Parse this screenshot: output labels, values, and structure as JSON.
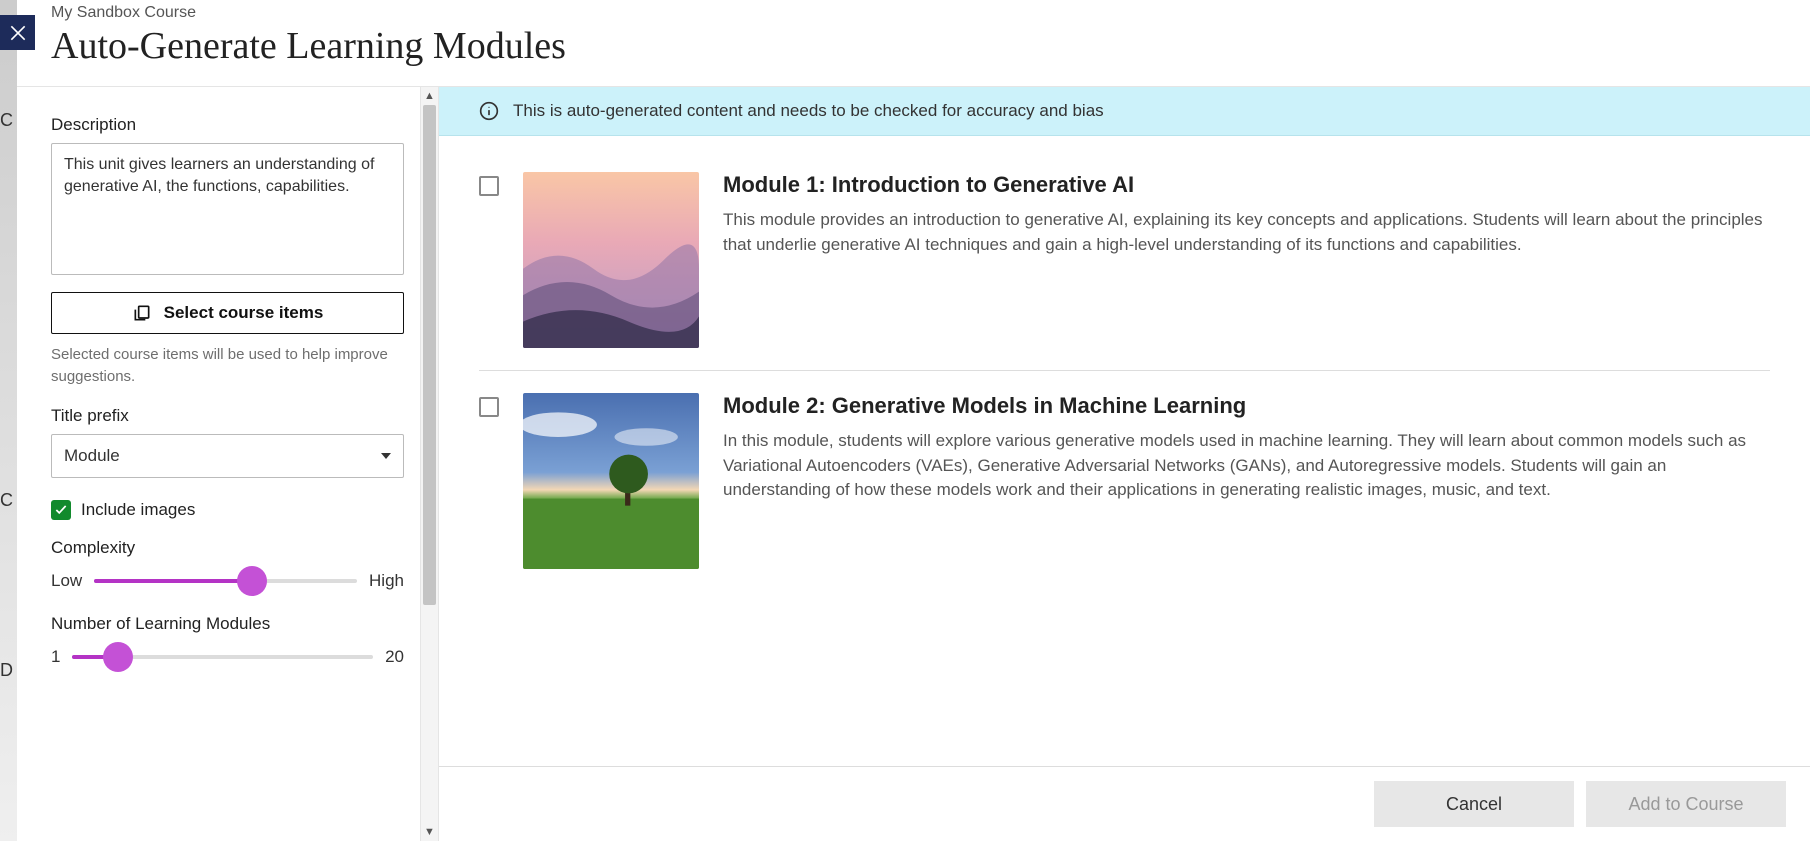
{
  "breadcrumb": "My Sandbox Course",
  "title": "Auto-Generate Learning Modules",
  "obscured": {
    "c1": "C",
    "c2": "C",
    "d": "D"
  },
  "settings": {
    "description_label": "Description",
    "description_value": "This unit gives learners an understanding of generative AI, the functions, capabilities.",
    "select_items_label": "Select course items",
    "select_items_helper": "Selected course items will be used to help improve suggestions.",
    "title_prefix_label": "Title prefix",
    "title_prefix_value": "Module",
    "include_images_label": "Include images",
    "include_images_checked": true,
    "complexity_label": "Complexity",
    "complexity_min": "Low",
    "complexity_max": "High",
    "num_modules_label": "Number of Learning Modules",
    "num_modules_min": "1",
    "num_modules_max": "20"
  },
  "banner": "This is auto-generated content and needs to be checked for accuracy and bias",
  "modules": [
    {
      "title": "Module 1: Introduction to Generative AI",
      "desc": "This module provides an introduction to generative AI, explaining its key concepts and applications. Students will learn about the principles that underlie generative AI techniques and gain a high-level understanding of its functions and capabilities."
    },
    {
      "title": "Module 2: Generative Models in Machine Learning",
      "desc": "In this module, students will explore various generative models used in machine learning. They will learn about common models such as Variational Autoencoders (VAEs), Generative Adversarial Networks (GANs), and Autoregressive models. Students will gain an understanding of how these models work and their applications in generating realistic images, music, and text."
    }
  ],
  "footer": {
    "cancel": "Cancel",
    "add": "Add to Course"
  }
}
